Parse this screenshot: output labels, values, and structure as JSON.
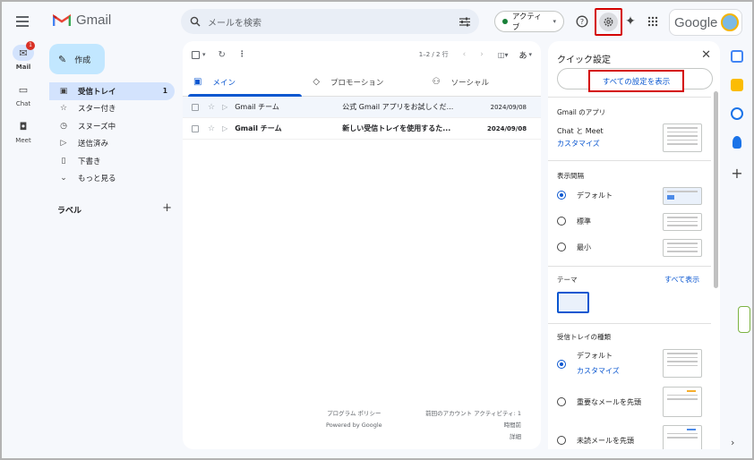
{
  "header": {
    "app_name": "Gmail",
    "search_placeholder": "メールを検索",
    "status_label": "アクティブ",
    "google_label": "Google"
  },
  "rail": [
    {
      "label": "Mail",
      "badge": "1",
      "icon": "mail-icon"
    },
    {
      "label": "Chat",
      "icon": "chat-icon"
    },
    {
      "label": "Meet",
      "icon": "video-icon"
    }
  ],
  "compose_label": "作成",
  "nav": [
    {
      "label": "受信トレイ",
      "count": "1",
      "icon": "inbox-icon"
    },
    {
      "label": "スター付き",
      "count": "",
      "icon": "star-icon"
    },
    {
      "label": "スヌーズ中",
      "count": "",
      "icon": "clock-icon"
    },
    {
      "label": "送信済み",
      "count": "",
      "icon": "send-icon"
    },
    {
      "label": "下書き",
      "count": "",
      "icon": "draft-icon"
    },
    {
      "label": "もっと見る",
      "count": "",
      "icon": "chevron-down-icon"
    }
  ],
  "labels_title": "ラベル",
  "toolbar": {
    "page_info": "1–2 / 2 行",
    "lang": "あ"
  },
  "tabs": [
    {
      "label": "メイン",
      "icon": "inbox-icon"
    },
    {
      "label": "プロモーション",
      "icon": "tag-icon"
    },
    {
      "label": "ソーシャル",
      "icon": "people-icon"
    }
  ],
  "emails": [
    {
      "sender": "Gmail チーム",
      "subject": "公式 Gmail アプリをお試しくだ...",
      "date": "2024/09/08",
      "unread": false
    },
    {
      "sender": "Gmail チーム",
      "subject": "新しい受信トレイを使用するた...",
      "date": "2024/09/08",
      "unread": true
    }
  ],
  "footer": {
    "policy": "プログラム ポリシー",
    "powered": "Powered by Google",
    "last_activity": "前回のアカウント アクティビティ: 1",
    "time_ago": "時間前",
    "details": "詳細"
  },
  "quick_settings": {
    "title": "クイック設定",
    "all_settings": "すべての設定を表示",
    "apps_title": "Gmail のアプリ",
    "chat_meet": "Chat と Meet",
    "customize": "カスタマイズ",
    "density_title": "表示間隔",
    "density_options": [
      "デフォルト",
      "標準",
      "最小"
    ],
    "theme_title": "テーマ",
    "theme_all": "すべて表示",
    "inbox_type_title": "受信トレイの種類",
    "inbox_options": [
      "デフォルト",
      "重要なメールを先頭",
      "未読メールを先頭"
    ],
    "inbox_customize": "カスタマイズ"
  },
  "colors": {
    "accent": "#0b57d0",
    "highlight_box": "#d40000",
    "nav_active": "#d3e3fd",
    "compose": "#c2e7ff"
  }
}
